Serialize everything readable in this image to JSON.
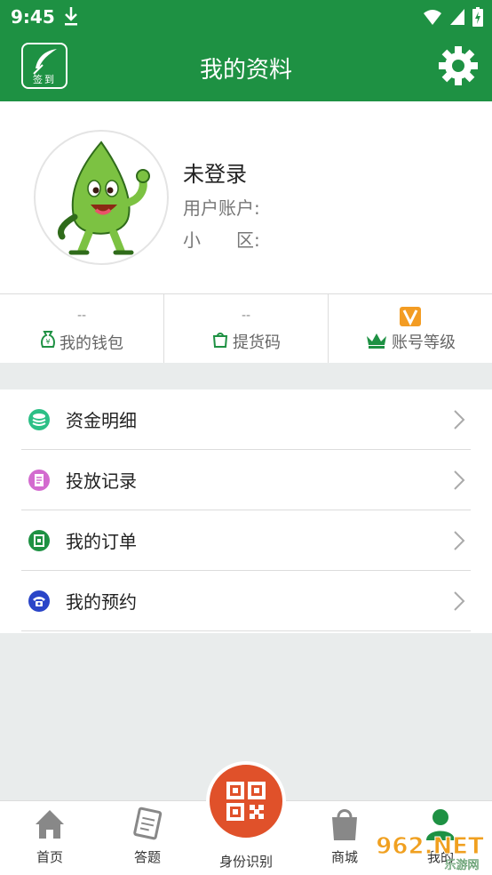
{
  "status_bar": {
    "time": "9:45"
  },
  "app_bar": {
    "title": "我的资料",
    "signin_label": "签到"
  },
  "profile": {
    "name": "未登录",
    "account_label": "用户账户:",
    "area_label": "小　　区:"
  },
  "stats": [
    {
      "value": "--",
      "label": "我的钱包",
      "icon": "money-bag-icon"
    },
    {
      "value": "--",
      "label": "提货码",
      "icon": "bag-icon"
    },
    {
      "value": "",
      "label": "账号等级",
      "icon": "crown-icon"
    }
  ],
  "menu": [
    {
      "label": "资金明细",
      "icon": "coin-stack-icon",
      "color": "#2cbf86"
    },
    {
      "label": "投放记录",
      "icon": "document-icon",
      "color": "#d36bcf"
    },
    {
      "label": "我的订单",
      "icon": "order-icon",
      "color": "#1e9143"
    },
    {
      "label": "我的预约",
      "icon": "phone-icon",
      "color": "#2a45c8"
    }
  ],
  "bottom_nav": {
    "home": "首页",
    "quiz": "答题",
    "id": "身份识别",
    "shop": "商城",
    "mine": "我的"
  },
  "watermark": {
    "text": "962.NET",
    "subtext": "乐游网"
  },
  "colors": {
    "brand": "#1e9143",
    "accent": "#e0512a"
  }
}
